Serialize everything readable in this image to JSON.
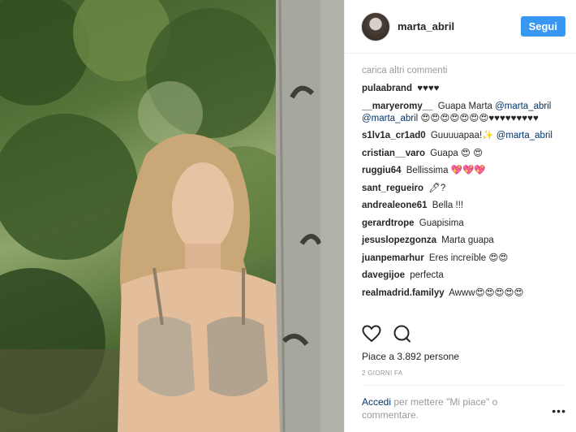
{
  "header": {
    "username": "marta_abril",
    "follow_label": "Segui"
  },
  "comments": {
    "load_more": "carica altri commenti",
    "items": [
      {
        "user": "pulaabrand",
        "text": "♥♥♥♥"
      },
      {
        "user": "__maryeromy__",
        "text": "Guapa Marta",
        "mention": "@marta_abril @marta_abril",
        "after": "😍😍😍😍😍😍😍♥♥♥♥♥♥♥♥♥"
      },
      {
        "user": "s1lv1a_cr1ad0",
        "text": "Guuuuapaa!✨",
        "mention": "@marta_abril"
      },
      {
        "user": "cristian__varo",
        "text": "Guapa 😍 😍"
      },
      {
        "user": "ruggiu64",
        "text": "Bellissima 💖💖💖"
      },
      {
        "user": "sant_regueiro",
        "text": "🖊?"
      },
      {
        "user": "andrealeone61",
        "text": "Bella !!!"
      },
      {
        "user": "gerardtrope",
        "text": "Guapisima"
      },
      {
        "user": "jesuslopezgonza",
        "text": "Marta guapa"
      },
      {
        "user": "juanpemarhur",
        "text": "Eres increíble 😍😍"
      },
      {
        "user": "davegijoe",
        "text": "perfecta"
      },
      {
        "user": "realmadrid.familyy",
        "text": "Awww😍😍😍😍😍"
      }
    ]
  },
  "icons": {
    "like": "heart-icon",
    "comment": "comment-bubble-icon",
    "more": "ellipsis-icon"
  },
  "likes": "Piace a 3.892 persone",
  "time": "2 GIORNI FA",
  "login": {
    "link": "Accedi",
    "rest": "per mettere \"Mi piace\" o commentare."
  },
  "more_label": "•••",
  "colors": {
    "accent": "#3897f0",
    "link": "#003569",
    "muted": "#999999"
  }
}
